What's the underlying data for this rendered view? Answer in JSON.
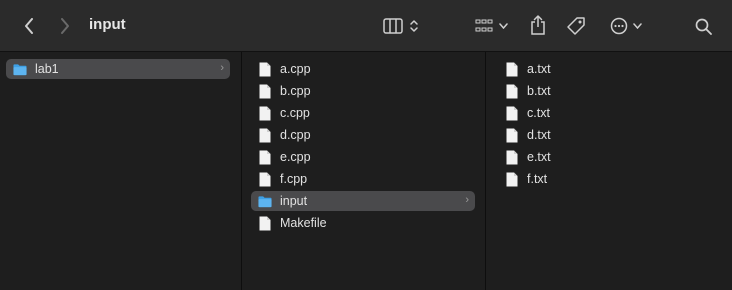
{
  "window": {
    "title": "input"
  },
  "toolbar": {
    "back_icon": "chevron-left-icon",
    "forward_icon": "chevron-right-icon",
    "view_icon": "columns-view-icon",
    "group_icon": "grid-group-icon",
    "share_icon": "share-icon",
    "tag_icon": "tag-icon",
    "more_icon": "ellipsis-circle-icon",
    "search_icon": "search-icon"
  },
  "columns": [
    {
      "items": [
        {
          "label": "lab1",
          "type": "folder",
          "selected": true
        }
      ]
    },
    {
      "items": [
        {
          "label": "a.cpp",
          "type": "file"
        },
        {
          "label": "b.cpp",
          "type": "file"
        },
        {
          "label": "c.cpp",
          "type": "file"
        },
        {
          "label": "d.cpp",
          "type": "file"
        },
        {
          "label": "e.cpp",
          "type": "file"
        },
        {
          "label": "f.cpp",
          "type": "file"
        },
        {
          "label": "input",
          "type": "folder",
          "selected": true
        },
        {
          "label": "Makefile",
          "type": "file"
        }
      ]
    },
    {
      "items": [
        {
          "label": "a.txt",
          "type": "file"
        },
        {
          "label": "b.txt",
          "type": "file"
        },
        {
          "label": "c.txt",
          "type": "file"
        },
        {
          "label": "d.txt",
          "type": "file"
        },
        {
          "label": "e.txt",
          "type": "file"
        },
        {
          "label": "f.txt",
          "type": "file"
        }
      ]
    }
  ],
  "colors": {
    "folder": "#3ea0e6",
    "selection": "#4a4a4c",
    "background": "#1e1e1e",
    "toolbar": "#2b2b2b"
  }
}
